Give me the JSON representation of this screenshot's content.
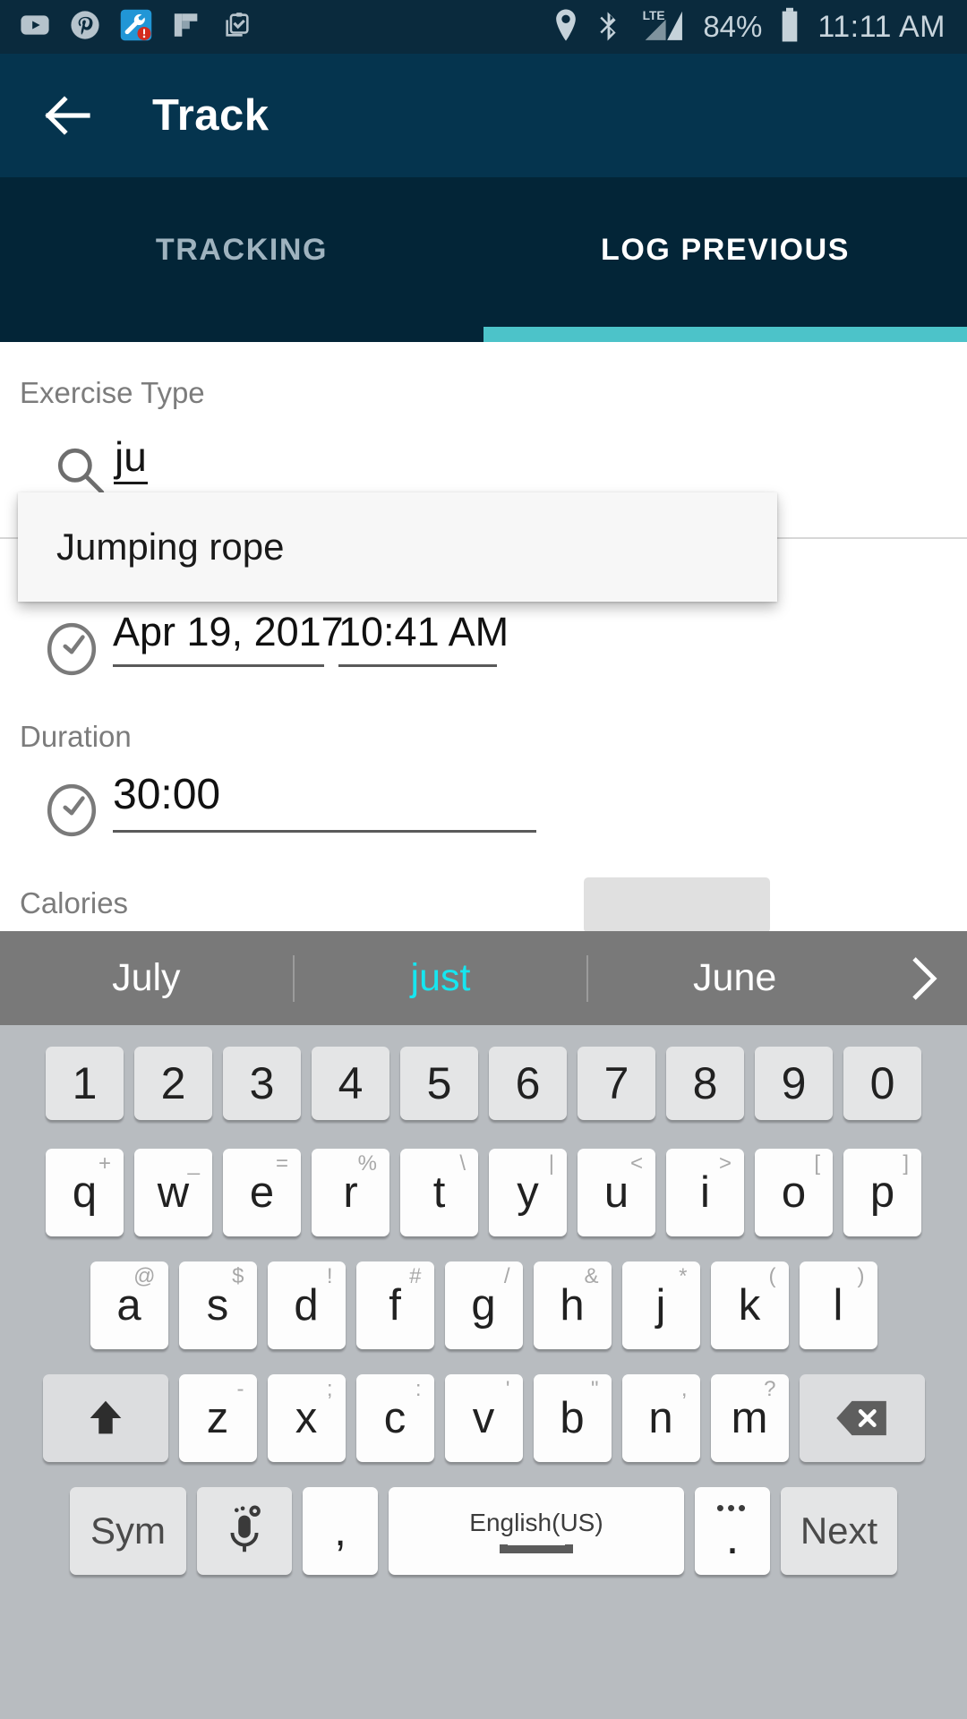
{
  "status_bar": {
    "time": "11:11 AM",
    "battery_percent": "84%",
    "signal_label": "LTE",
    "icons": [
      "youtube-icon",
      "pinterest-icon",
      "wrench-alert-icon",
      "flipboard-icon",
      "clipboard-check-icon",
      "location-pin-icon",
      "bluetooth-icon",
      "signal-bars-icon",
      "battery-icon"
    ],
    "colors": {
      "background": "#0a2a3d",
      "foreground": "#c5d2da"
    }
  },
  "app_bar": {
    "title": "Track",
    "back_icon": "arrow-left-icon",
    "background": "#05344e"
  },
  "tabs": {
    "background": "#032537",
    "indicator_color": "#4cc3c9",
    "items": [
      {
        "label": "TRACKING",
        "active": false
      },
      {
        "label": "LOG PREVIOUS",
        "active": true
      }
    ]
  },
  "form": {
    "exercise_type_label": "Exercise Type",
    "search": {
      "value": "ju",
      "icon": "search-icon",
      "focus_color": "#d8315b"
    },
    "suggestions": [
      "Jumping rope"
    ],
    "datetime": {
      "icon": "clock-icon",
      "date": "Apr 19, 2017",
      "time": "10:41 AM"
    },
    "duration_label": "Duration",
    "duration": {
      "icon": "clock-icon",
      "value": "30:00"
    },
    "calories_label": "Calories"
  },
  "keyboard": {
    "suggestion_strip": {
      "items": [
        {
          "text": "July",
          "highlighted": false
        },
        {
          "text": "just",
          "highlighted": true
        },
        {
          "text": "June",
          "highlighted": false
        }
      ],
      "expand_icon": "chevron-right-icon",
      "background": "#797979",
      "highlight_color": "#16e6f0"
    },
    "number_row": [
      "1",
      "2",
      "3",
      "4",
      "5",
      "6",
      "7",
      "8",
      "9",
      "0"
    ],
    "row_q": [
      {
        "key": "q",
        "hint": "+"
      },
      {
        "key": "w",
        "hint": "_"
      },
      {
        "key": "e",
        "hint": "="
      },
      {
        "key": "r",
        "hint": "%"
      },
      {
        "key": "t",
        "hint": "\\"
      },
      {
        "key": "y",
        "hint": "|"
      },
      {
        "key": "u",
        "hint": "<"
      },
      {
        "key": "i",
        "hint": ">"
      },
      {
        "key": "o",
        "hint": "["
      },
      {
        "key": "p",
        "hint": "]"
      }
    ],
    "row_a": [
      {
        "key": "a",
        "hint": "@"
      },
      {
        "key": "s",
        "hint": "$"
      },
      {
        "key": "d",
        "hint": "!"
      },
      {
        "key": "f",
        "hint": "#"
      },
      {
        "key": "g",
        "hint": "/"
      },
      {
        "key": "h",
        "hint": "&"
      },
      {
        "key": "j",
        "hint": "*"
      },
      {
        "key": "k",
        "hint": "("
      },
      {
        "key": "l",
        "hint": ")"
      }
    ],
    "row_z": [
      {
        "key": "z",
        "hint": "-"
      },
      {
        "key": "x",
        "hint": ";"
      },
      {
        "key": "c",
        "hint": ":"
      },
      {
        "key": "v",
        "hint": "'"
      },
      {
        "key": "b",
        "hint": "\""
      },
      {
        "key": "n",
        "hint": ","
      },
      {
        "key": "m",
        "hint": "?"
      }
    ],
    "shift_icon": "shift-arrow-up-icon",
    "delete_icon": "backspace-icon",
    "function_row": {
      "sym_label": "Sym",
      "mic_icon": "microphone-settings-icon",
      "comma_label": ",",
      "space_label": "English(US)",
      "space_icon": "spacebar-icon",
      "period_label": ".",
      "period_hint": "•••",
      "next_label": "Next"
    },
    "background": "#b8bcc0"
  }
}
